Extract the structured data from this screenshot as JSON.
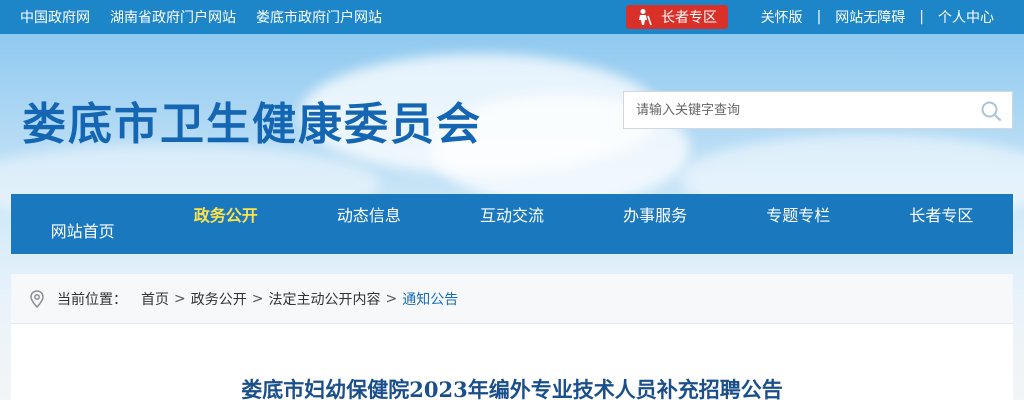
{
  "topbar": {
    "links": [
      "中国政府网",
      "湖南省政府门户网站",
      "娄底市政府门户网站"
    ],
    "elder_button": "长者专区",
    "right_links": [
      "关怀版",
      "网站无障碍",
      "个人中心"
    ],
    "separator": "|"
  },
  "header": {
    "site_title": "娄底市卫生健康委员会",
    "search_placeholder": "请输入关键字查询"
  },
  "nav": {
    "items": [
      "网站首页",
      "政务公开",
      "动态信息",
      "互动交流",
      "办事服务",
      "专题专栏",
      "长者专区"
    ],
    "active": "政务公开"
  },
  "breadcrumb": {
    "label": "当前位置：",
    "items": [
      "首页",
      "政务公开",
      "法定主动公开内容",
      "通知公告"
    ],
    "arrow": ">"
  },
  "article": {
    "title": "娄底市妇幼保健院2023年编外专业技术人员补充招聘公告"
  },
  "colors": {
    "topbar": "#1d86c9",
    "nav": "#1a79be",
    "active_nav_text": "#ffe14a",
    "title": "#1466b3",
    "elder_button": "#d9302a"
  }
}
